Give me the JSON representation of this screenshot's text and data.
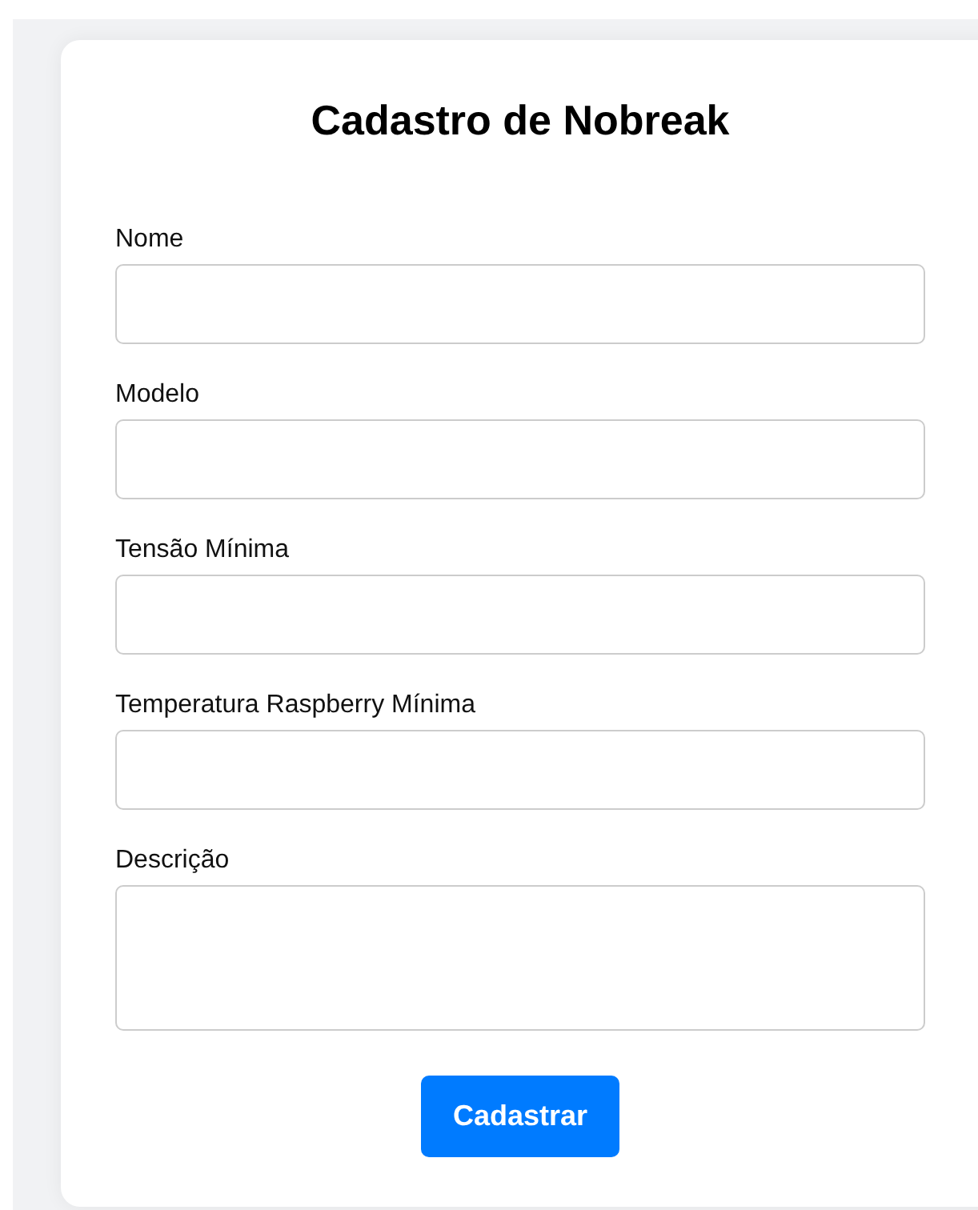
{
  "title": "Cadastro de Nobreak",
  "fields": [
    {
      "label": "Nome",
      "kind": "input"
    },
    {
      "label": "Modelo",
      "kind": "input"
    },
    {
      "label": "Tensão Mínima",
      "kind": "input"
    },
    {
      "label": "Temperatura Raspberry Mínima",
      "kind": "input"
    },
    {
      "label": "Descrição",
      "kind": "textarea"
    }
  ],
  "submit": "Cadastrar"
}
